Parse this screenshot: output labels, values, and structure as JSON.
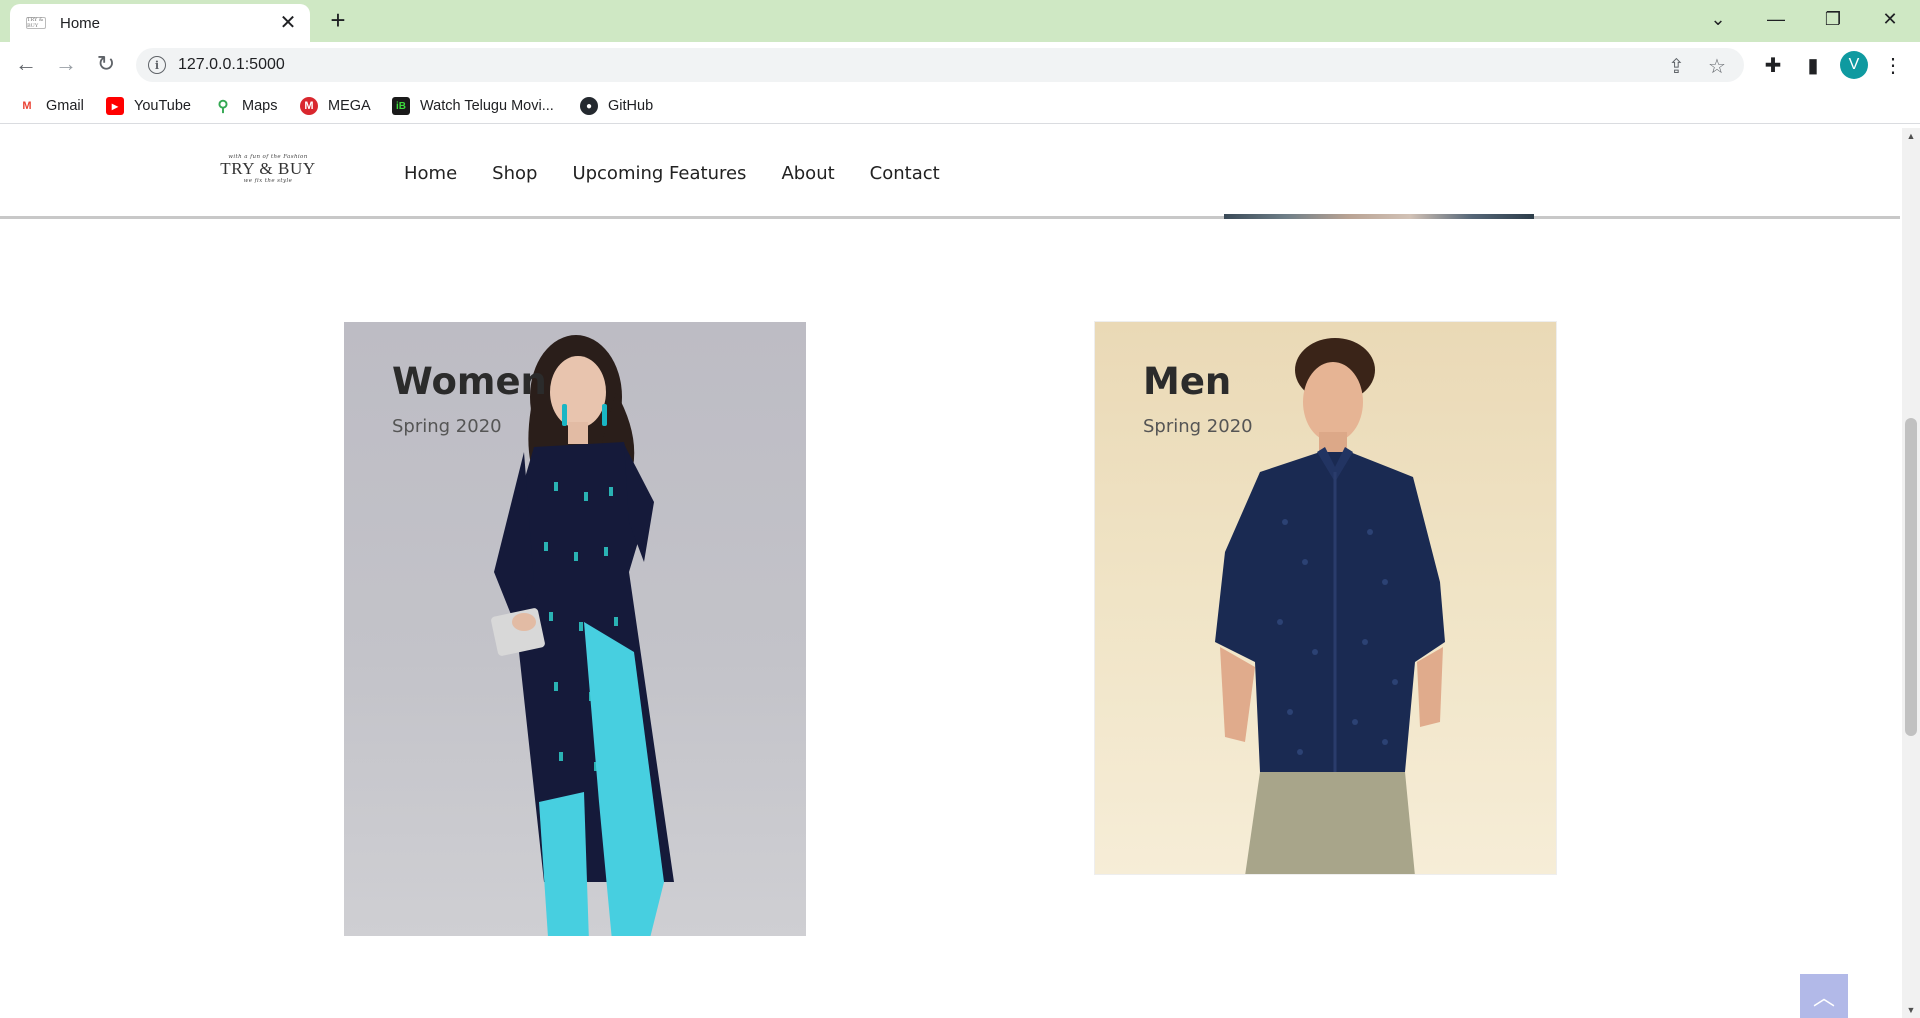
{
  "browser": {
    "tab": {
      "title": "Home",
      "favicon_text": "TRY & BUY"
    },
    "address": {
      "url": "127.0.0.1:5000"
    },
    "profile_initial": "V",
    "bookmarks": [
      {
        "label": "Gmail",
        "icon": "gmail-icon",
        "color": "#ea4335"
      },
      {
        "label": "YouTube",
        "icon": "youtube-icon",
        "color": "#ff0000"
      },
      {
        "label": "Maps",
        "icon": "maps-icon",
        "color": "#34a853"
      },
      {
        "label": "MEGA",
        "icon": "mega-icon",
        "color": "#d9272e"
      },
      {
        "label": "Watch Telugu Movi...",
        "icon": "ibomma-icon",
        "color": "#1a1a1a"
      },
      {
        "label": "GitHub",
        "icon": "github-icon",
        "color": "#24292f"
      }
    ]
  },
  "site": {
    "logo": {
      "top": "with a fun of the Fashion",
      "main": "TRY & BUY",
      "bottom": "we fix the style"
    },
    "nav": [
      "Home",
      "Shop",
      "Upcoming Features",
      "About",
      "Contact"
    ]
  },
  "categories": [
    {
      "title": "Women",
      "subtitle": "Spring 2020",
      "bg_color": "#c3c3c9"
    },
    {
      "title": "Men",
      "subtitle": "Spring 2020",
      "bg_color": "#f0e4c6"
    }
  ],
  "colors": {
    "tabstrip": "#cfe8c4",
    "back_to_top": "#b2b9e8",
    "avatar": "#0f9aa0"
  }
}
